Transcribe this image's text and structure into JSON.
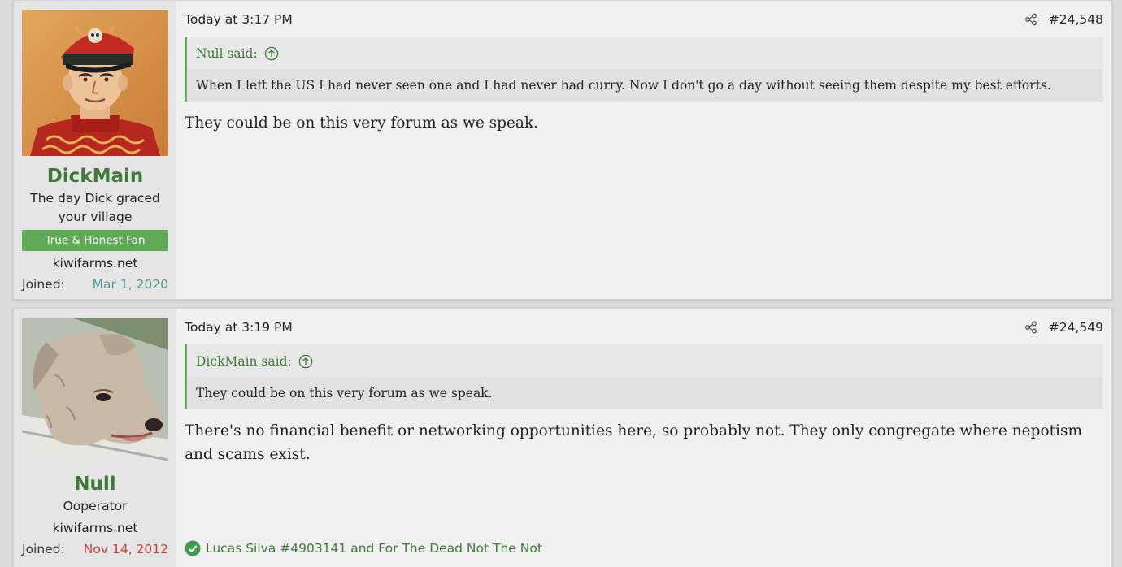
{
  "posts": [
    {
      "user": {
        "name": "DickMain",
        "title": "The day Dick graced your village",
        "banner": "True & Honest Fan",
        "site": "kiwifarms.net",
        "joined_label": "Joined:",
        "joined_date": "Mar 1, 2020",
        "avatar": "general-cartoon-avatar"
      },
      "time": "Today at 3:17 PM",
      "number": "#24,548",
      "quote": {
        "author": "Null said:",
        "text": "When I left the US I had never seen one and I had never had curry. Now I don't go a day without seeing them despite my best efforts."
      },
      "message": "They could be on this very forum as we speak."
    },
    {
      "user": {
        "name": "Null",
        "title": "Ooperator",
        "site": "kiwifarms.net",
        "joined_label": "Joined:",
        "joined_date": "Nov 14, 2012",
        "avatar": "dog-cartoon-avatar"
      },
      "time": "Today at 3:19 PM",
      "number": "#24,549",
      "quote": {
        "author": "DickMain said:",
        "text": "They could be on this very forum as we speak."
      },
      "message": "There's no financial benefit or networking opportunities here, so probably not. They only congregate where nepotism and scams exist.",
      "reactions": "Lucas Silva #4903141 and For The Dead Not The Not"
    }
  ],
  "colors": {
    "username": "#3e7a38",
    "banner": "#5fa957",
    "quote_border": "#6aa863",
    "joined_teal": "#4d9e92",
    "joined_red": "#c8403a"
  }
}
